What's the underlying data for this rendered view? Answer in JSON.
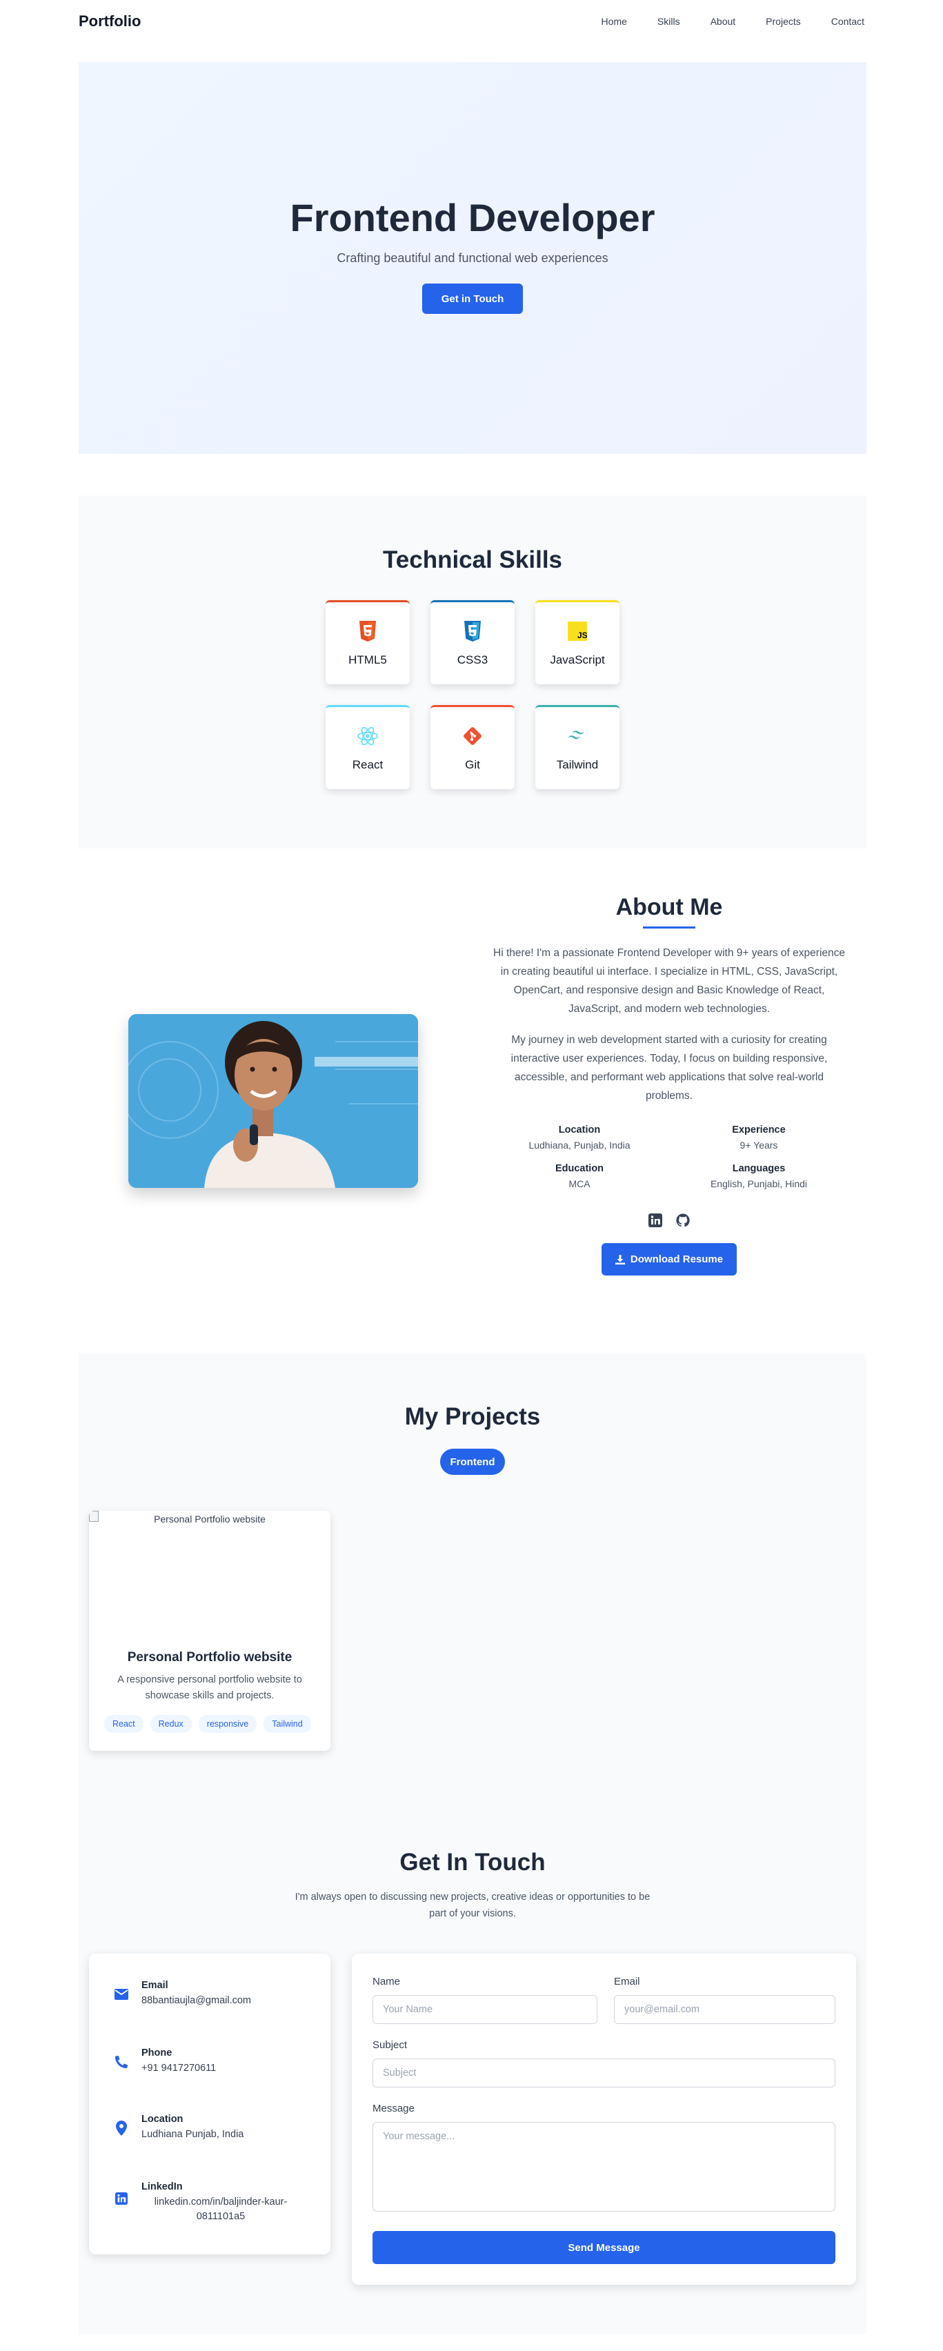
{
  "nav": {
    "brand": "Portfolio",
    "links": [
      "Home",
      "Skills",
      "About",
      "Projects",
      "Contact"
    ]
  },
  "hero": {
    "title": "Frontend Developer",
    "subtitle": "Crafting beautiful and functional web experiences",
    "cta": "Get in Touch"
  },
  "skills": {
    "title": "Technical Skills",
    "items": [
      {
        "name": "HTML5",
        "icon": "html5-icon",
        "color": "#e34f26"
      },
      {
        "name": "CSS3",
        "icon": "css3-icon",
        "color": "#1572b6"
      },
      {
        "name": "JavaScript",
        "icon": "javascript-icon",
        "color": "#f7df1e"
      },
      {
        "name": "React",
        "icon": "react-icon",
        "color": "#61dafb"
      },
      {
        "name": "Git",
        "icon": "git-icon",
        "color": "#f05032"
      },
      {
        "name": "Tailwind",
        "icon": "tailwind-icon",
        "color": "#38b2ac"
      }
    ]
  },
  "about": {
    "title": "About Me",
    "para1": "Hi there! I'm a passionate Frontend Developer with 9+ years of experience in creating beautiful ui interface. I specialize in HTML, CSS, JavaScript, OpenCart, and responsive design and Basic Knowledge of React, JavaScript, and modern web technologies.",
    "para2": "My journey in web development started with a curiosity for creating interactive user experiences. Today, I focus on building responsive, accessible, and performant web applications that solve real-world problems.",
    "info": [
      {
        "label": "Location",
        "value": "Ludhiana, Punjab, India"
      },
      {
        "label": "Experience",
        "value": "9+ Years"
      },
      {
        "label": "Education",
        "value": "MCA"
      },
      {
        "label": "Languages",
        "value": "English, Punjabi, Hindi"
      }
    ],
    "download": "Download Resume"
  },
  "projects": {
    "title": "My Projects",
    "filter": "Frontend",
    "card": {
      "image_alt": "Personal Portfolio website",
      "title": "Personal Portfolio website",
      "desc": "A responsive personal portfolio website to showcase skills and projects.",
      "tags": [
        "React",
        "Redux",
        "responsive",
        "Tailwind"
      ]
    }
  },
  "contact": {
    "title": "Get In Touch",
    "subtitle": "I'm always open to discussing new projects, creative ideas or opportunities to be part of your visions.",
    "info": {
      "email_label": "Email",
      "email": "88bantiaujla@gmail.com",
      "phone_label": "Phone",
      "phone": "+91 9417270611",
      "location_label": "Location",
      "location": "Ludhiana Punjab, India",
      "linkedin_label": "LinkedIn",
      "linkedin": "linkedin.com/in/baljinder-kaur-0811101a5"
    },
    "form": {
      "name_label": "Name",
      "name_placeholder": "Your Name",
      "email_label": "Email",
      "email_placeholder": "your@email.com",
      "subject_label": "Subject",
      "subject_placeholder": "Subject",
      "message_label": "Message",
      "message_placeholder": "Your message...",
      "send": "Send Message"
    }
  }
}
